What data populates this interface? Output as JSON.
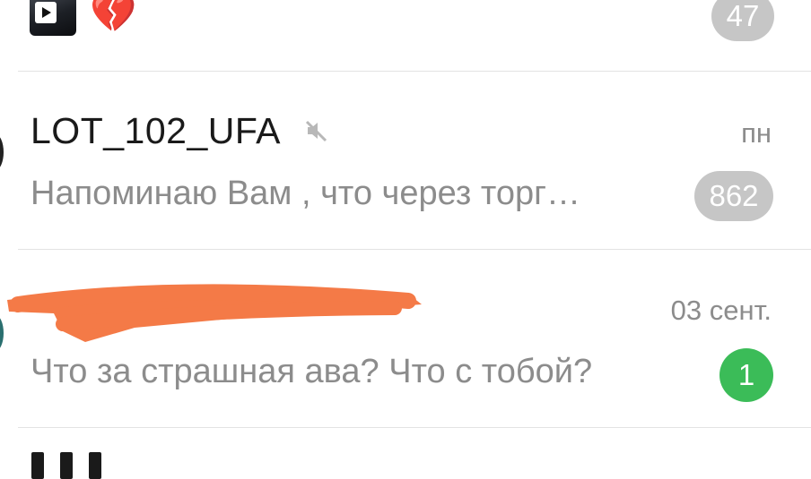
{
  "chats": [
    {
      "unread_count": "47",
      "broken_heart": "💔"
    },
    {
      "title": "LOT_102_UFA",
      "muted": true,
      "time": "пн",
      "preview": "Напоминаю Вам , что через торг…",
      "unread_count": "862"
    },
    {
      "title": "",
      "time": "03 сент.",
      "preview": "Что за страшная ава? Что с тобой?",
      "unread_count": "1"
    }
  ],
  "colors": {
    "badge_muted": "#c6c6c6",
    "badge_active": "#3bbc58",
    "redaction": "#f47a47"
  }
}
